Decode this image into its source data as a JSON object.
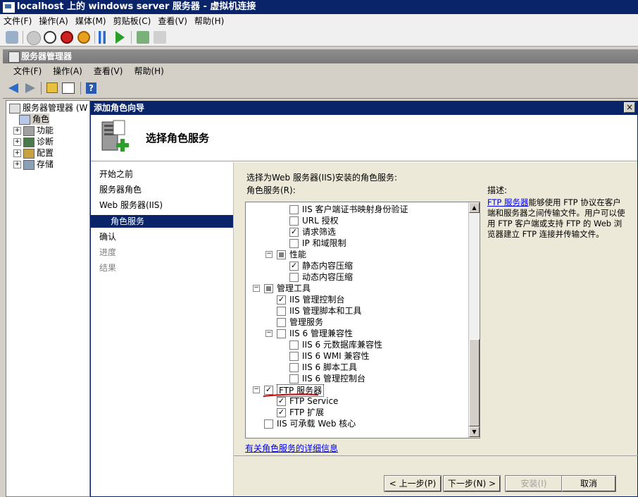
{
  "vm": {
    "title": "localhost 上的 windows server 服务器 - 虚拟机连接",
    "menu": [
      "文件(F)",
      "操作(A)",
      "媒体(M)",
      "剪贴板(C)",
      "查看(V)",
      "帮助(H)"
    ]
  },
  "server_manager": {
    "title": "服务器管理器",
    "menu": [
      "文件(F)",
      "操作(A)",
      "查看(V)",
      "帮助(H)"
    ]
  },
  "tree": {
    "root": "服务器管理器 (W",
    "items": [
      "角色",
      "功能",
      "诊断",
      "配置",
      "存储"
    ]
  },
  "wizard": {
    "title": "添加角色向导",
    "close": "×",
    "heading": "选择角色服务",
    "nav": [
      {
        "label": "开始之前",
        "state": "normal"
      },
      {
        "label": "服务器角色",
        "state": "normal"
      },
      {
        "label": "Web 服务器(IIS)",
        "state": "normal"
      },
      {
        "label": "角色服务",
        "state": "selected"
      },
      {
        "label": "确认",
        "state": "normal"
      },
      {
        "label": "进度",
        "state": "disabled"
      },
      {
        "label": "结果",
        "state": "disabled"
      }
    ],
    "instruction": "选择为Web 服务器(IIS)安装的角色服务:",
    "services_label": "角色服务(R):",
    "description_label": "描述:",
    "description_link": "FTP 服务器",
    "description_text": "能够使用 FTP 协议在客户端和服务器之间传输文件。用户可以使用 FTP 客户端或支持 FTP 的 Web 浏览器建立 FTP 连接并传输文件。",
    "services": [
      {
        "label": "IIS 客户端证书映射身份验证",
        "checked": "off",
        "level": 3
      },
      {
        "label": "URL 授权",
        "checked": "off",
        "level": 3
      },
      {
        "label": "请求筛选",
        "checked": "on",
        "level": 3
      },
      {
        "label": "IP 和域限制",
        "checked": "off",
        "level": 3
      },
      {
        "label": "性能",
        "checked": "mixed",
        "level": 2,
        "expander": true
      },
      {
        "label": "静态内容压缩",
        "checked": "on",
        "level": 3
      },
      {
        "label": "动态内容压缩",
        "checked": "off",
        "level": 3
      },
      {
        "label": "管理工具",
        "checked": "mixed",
        "level": 1,
        "expander": true
      },
      {
        "label": "IIS 管理控制台",
        "checked": "on",
        "level": 2
      },
      {
        "label": "IIS 管理脚本和工具",
        "checked": "off",
        "level": 2
      },
      {
        "label": "管理服务",
        "checked": "off",
        "level": 2
      },
      {
        "label": "IIS 6 管理兼容性",
        "checked": "off",
        "level": 2,
        "expander": true
      },
      {
        "label": "IIS 6 元数据库兼容性",
        "checked": "off",
        "level": 3
      },
      {
        "label": "IIS 6 WMI 兼容性",
        "checked": "off",
        "level": 3
      },
      {
        "label": "IIS 6 脚本工具",
        "checked": "off",
        "level": 3
      },
      {
        "label": "IIS 6 管理控制台",
        "checked": "off",
        "level": 3
      },
      {
        "label": "FTP 服务器",
        "checked": "on",
        "level": 1,
        "expander": true,
        "highlight": true
      },
      {
        "label": "FTP Service",
        "checked": "on",
        "level": 2
      },
      {
        "label": "FTP 扩展",
        "checked": "on",
        "level": 2
      },
      {
        "label": "IIS 可承载 Web 核心",
        "checked": "off",
        "level": 1
      }
    ],
    "more_link": "有关角色服务的详细信息",
    "buttons": {
      "back": "< 上一步(P)",
      "next": "下一步(N) >",
      "install": "安装(I)",
      "cancel": "取消"
    }
  },
  "colors": {
    "titlebar": "#0a246a",
    "annotation": "#cc0000"
  }
}
